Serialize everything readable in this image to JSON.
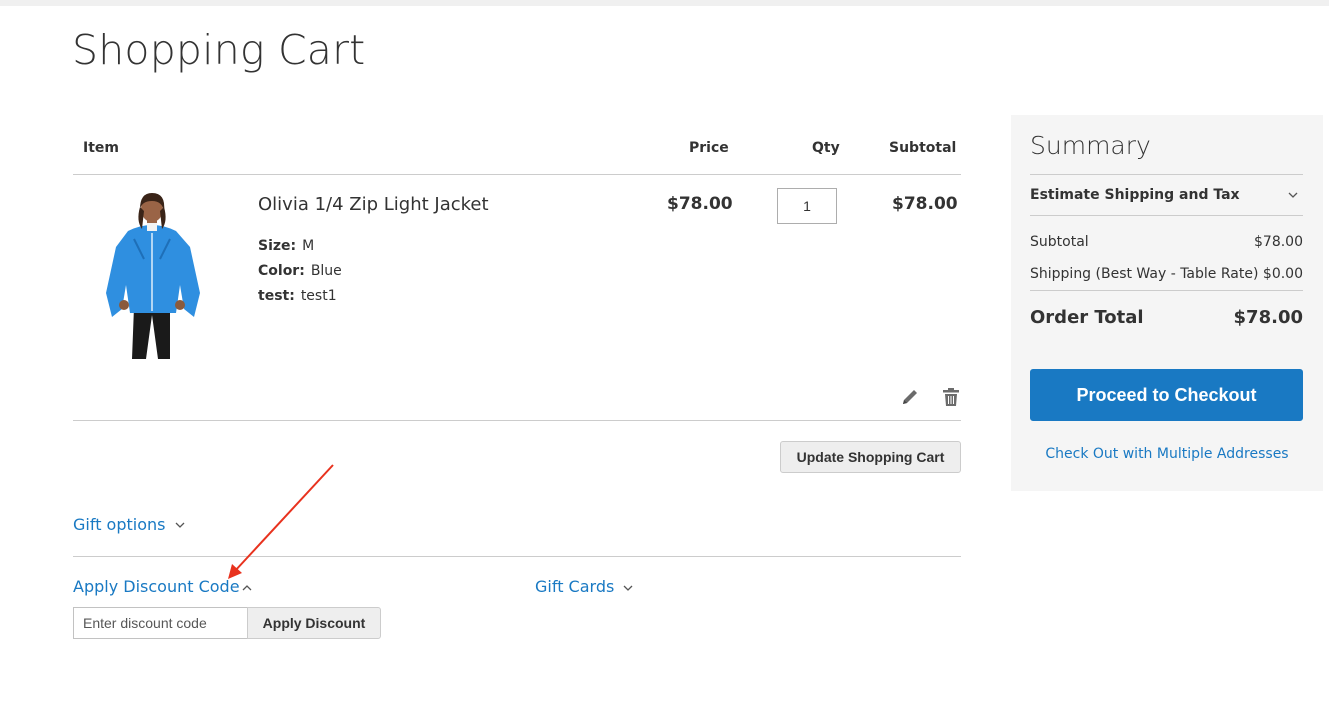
{
  "page": {
    "title": "Shopping Cart"
  },
  "cart": {
    "headers": {
      "item": "Item",
      "price": "Price",
      "qty": "Qty",
      "subtotal": "Subtotal"
    },
    "items": [
      {
        "name": "Olivia 1/4 Zip Light Jacket",
        "options": [
          {
            "label": "Size:",
            "value": "M"
          },
          {
            "label": "Color:",
            "value": "Blue"
          },
          {
            "label": "test:",
            "value": "test1"
          }
        ],
        "price": "$78.00",
        "qty": "1",
        "subtotal": "$78.00"
      }
    ],
    "update_label": "Update Shopping Cart"
  },
  "sections": {
    "gift_options": "Gift options",
    "discount": {
      "label": "Apply Discount Code",
      "placeholder": "Enter discount code",
      "apply_label": "Apply Discount"
    },
    "gift_cards": "Gift Cards"
  },
  "summary": {
    "title": "Summary",
    "estimate": "Estimate Shipping and Tax",
    "subtotal_label": "Subtotal",
    "subtotal_value": "$78.00",
    "shipping_label": "Shipping (Best Way - Table Rate)",
    "shipping_value": "$0.00",
    "total_label": "Order Total",
    "total_value": "$78.00",
    "checkout_label": "Proceed to Checkout",
    "multi_label": "Check Out with Multiple Addresses"
  },
  "colors": {
    "link": "#1979c3",
    "checkout": "#1979c3",
    "annotation_arrow": "#e8321e"
  },
  "icons": [
    "pencil-icon",
    "trash-icon",
    "chevron-down-icon",
    "chevron-up-icon"
  ]
}
